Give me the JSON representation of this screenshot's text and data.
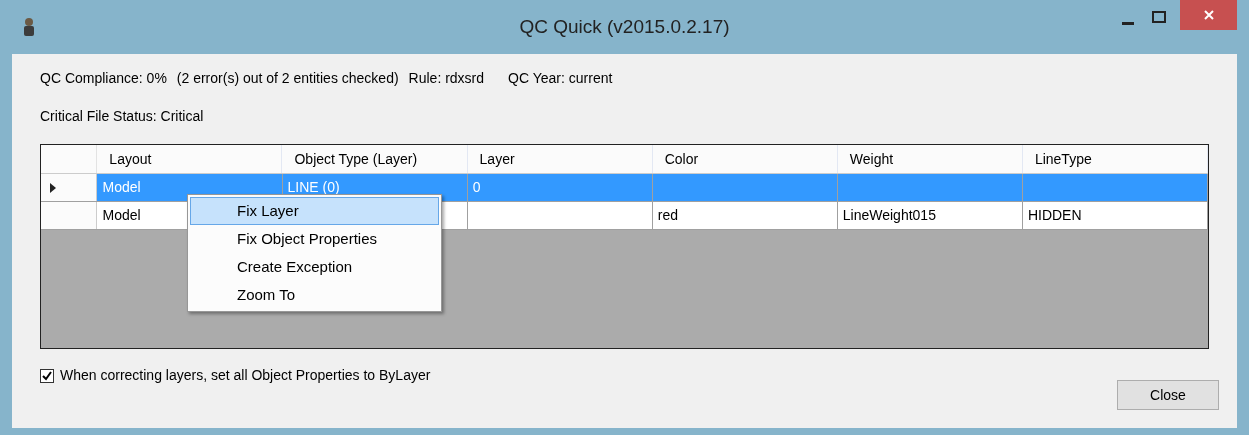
{
  "window": {
    "title": "QC Quick (v2015.0.2.17)"
  },
  "status": {
    "compliance": "QC Compliance: 0%",
    "errors": "(2 error(s) out of 2 entities checked)",
    "rule": "Rule: rdxsrd",
    "year": "QC Year: current",
    "critical": "Critical File Status: Critical"
  },
  "table": {
    "columns": [
      "Layout",
      "Object Type (Layer)",
      "Layer",
      "Color",
      "Weight",
      "LineType"
    ],
    "rows": [
      {
        "selected": true,
        "cells": [
          "Model",
          "LINE (0)",
          "0",
          null,
          null,
          null
        ]
      },
      {
        "selected": false,
        "cells": [
          "Model",
          null,
          null,
          "red",
          "LineWeight015",
          "HIDDEN"
        ]
      }
    ]
  },
  "context_menu": {
    "items": [
      {
        "label": "Fix Layer",
        "selected": true
      },
      {
        "label": "Fix Object Properties",
        "selected": false
      },
      {
        "label": "Create Exception",
        "selected": false
      },
      {
        "label": "Zoom To",
        "selected": false
      }
    ]
  },
  "option": {
    "label": "When correcting layers, set all Object Properties to ByLayer",
    "checked": true
  },
  "buttons": [
    "Close"
  ]
}
